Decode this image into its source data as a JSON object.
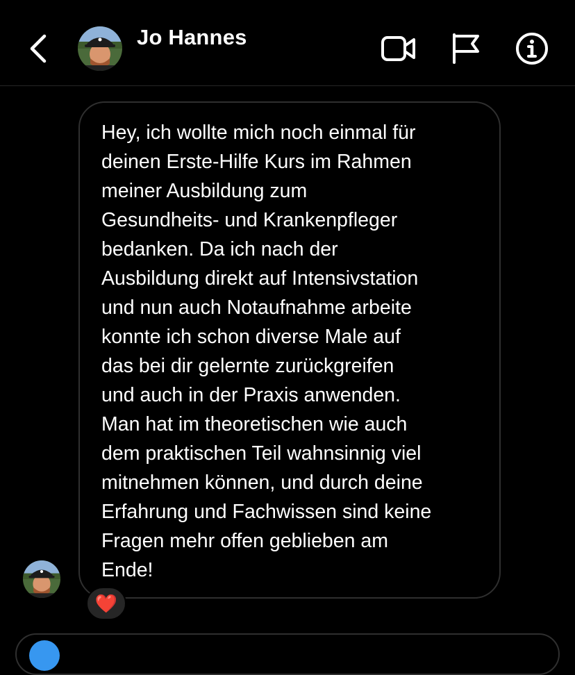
{
  "header": {
    "contact_name": "Jo Hannes",
    "icons": [
      "back-icon",
      "video-call-icon",
      "flag-icon",
      "info-icon"
    ]
  },
  "message": {
    "text": "Hey, ich wollte mich noch einmal für\ndeinen Erste-Hilfe Kurs im Rahmen\nmeiner Ausbildung zum\nGesundheits- und Krankenpfleger\nbedanken. Da ich nach der\nAusbildung direkt auf Intensivstation\nund nun auch Notaufnahme arbeite\nkonnte ich schon diverse Male auf\ndas bei dir gelernte zurückgreifen\nund auch in der Praxis anwenden.\nMan hat im theoretischen wie auch\ndem praktischen Teil wahnsinnig viel\nmitnehmen können, und durch deine\nErfahrung und Fachwissen sind keine\nFragen mehr offen geblieben am\nEnde!",
    "reaction": "❤️"
  },
  "colors": {
    "background": "#000000",
    "bubble_border": "#2f2f2f",
    "reaction_bg": "#262626",
    "accent": "#3797f0"
  }
}
